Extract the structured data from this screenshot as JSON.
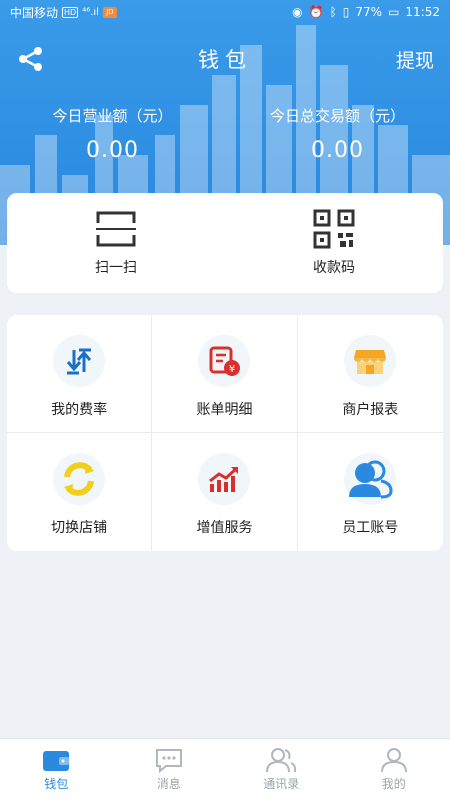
{
  "status_bar": {
    "carrier": "中国移动",
    "badge": "HD",
    "signal": "⁴⁶.ıl",
    "battery": "77%",
    "time": "11:52"
  },
  "header": {
    "title": "钱包",
    "withdraw_label": "提现",
    "stats": [
      {
        "label": "今日营业额（元）",
        "value": "0.00"
      },
      {
        "label": "今日总交易额（元）",
        "value": "0.00"
      }
    ]
  },
  "quick_actions": [
    {
      "label": "扫一扫",
      "icon": "scan-icon"
    },
    {
      "label": "收款码",
      "icon": "qr-code-icon"
    }
  ],
  "grid": [
    {
      "label": "我的费率",
      "icon": "rate-sort-icon",
      "color": "#1a6fc7"
    },
    {
      "label": "账单明细",
      "icon": "bill-detail-icon",
      "color": "#d9302b"
    },
    {
      "label": "商户报表",
      "icon": "store-icon",
      "color": "#f5a623"
    },
    {
      "label": "切换店铺",
      "icon": "switch-icon",
      "color": "#f2d01a"
    },
    {
      "label": "增值服务",
      "icon": "growth-chart-icon",
      "color": "#d9302b"
    },
    {
      "label": "员工账号",
      "icon": "staff-icon",
      "color": "#2b8ae0"
    }
  ],
  "tabs": [
    {
      "label": "钱包",
      "icon": "wallet-icon",
      "active": true
    },
    {
      "label": "消息",
      "icon": "message-icon",
      "active": false
    },
    {
      "label": "通讯录",
      "icon": "contacts-icon",
      "active": false
    },
    {
      "label": "我的",
      "icon": "profile-icon",
      "active": false
    }
  ],
  "colors": {
    "primary": "#2f8fe3",
    "accent": "#2b8ae0"
  }
}
